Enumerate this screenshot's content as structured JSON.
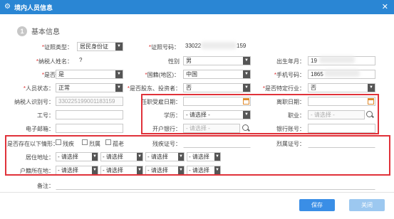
{
  "window": {
    "title": "境内人员信息",
    "close_glyph": "✕"
  },
  "section": {
    "number": "1",
    "title": "基本信息"
  },
  "fields": {
    "id_type": {
      "label": "证照类型：",
      "value": "居民身份证"
    },
    "id_number": {
      "label": "证照号码：",
      "value": "33022",
      "value_tail": "159"
    },
    "name": {
      "label": "纳税人姓名：",
      "value": "?"
    },
    "gender": {
      "label": "性别",
      "value": "男"
    },
    "birth": {
      "label": "出生年月：",
      "value": "19"
    },
    "employee": {
      "label": "是否雇员：",
      "value": "是"
    },
    "nationality": {
      "label": "国籍(地区)：",
      "value": "中国"
    },
    "mobile": {
      "label": "手机号码：",
      "value": "1865"
    },
    "status": {
      "label": "人员状态：",
      "value": "正常"
    },
    "shareholder": {
      "label": "是否股东、投资者：",
      "value": "否"
    },
    "special_industry": {
      "label": "是否特定行业：",
      "value": "否"
    },
    "taxpayer_id": {
      "label": "纳税人识别号：",
      "value": "330225199001183159"
    },
    "hire_date": {
      "label": "任职受雇日期：",
      "value": ""
    },
    "leave_date": {
      "label": "离职日期：",
      "value": ""
    },
    "employee_no": {
      "label": "工号：",
      "value": ""
    },
    "education": {
      "label": "学历：",
      "value": "- 请选择 -"
    },
    "position": {
      "label": "职业：",
      "value": "- 请选择 -"
    },
    "email": {
      "label": "电子邮箱：",
      "value": ""
    },
    "bank": {
      "label": "开户银行：",
      "value": "- 请选择 -"
    },
    "bank_account": {
      "label": "银行账号：",
      "value": ""
    },
    "situation": {
      "label": "是否存在以下情形：",
      "opt1": "残疾",
      "opt2": "烈属",
      "opt3": "孤老"
    },
    "disability_no": {
      "label": "残疾证号："
    },
    "martyr_no": {
      "label": "烈属证号："
    },
    "residence": {
      "label": "居住地址："
    },
    "household": {
      "label": "户籍所在地："
    },
    "remark": {
      "label": "备注："
    }
  },
  "address_select": "- 请选择",
  "buttons": {
    "save": "保存",
    "close": "关闭"
  },
  "colors": {
    "titlebar": "#2a86d4",
    "highlight": "#e0323a",
    "save_btn": "#3a8ee6",
    "close_btn": "#9cc8f0"
  }
}
